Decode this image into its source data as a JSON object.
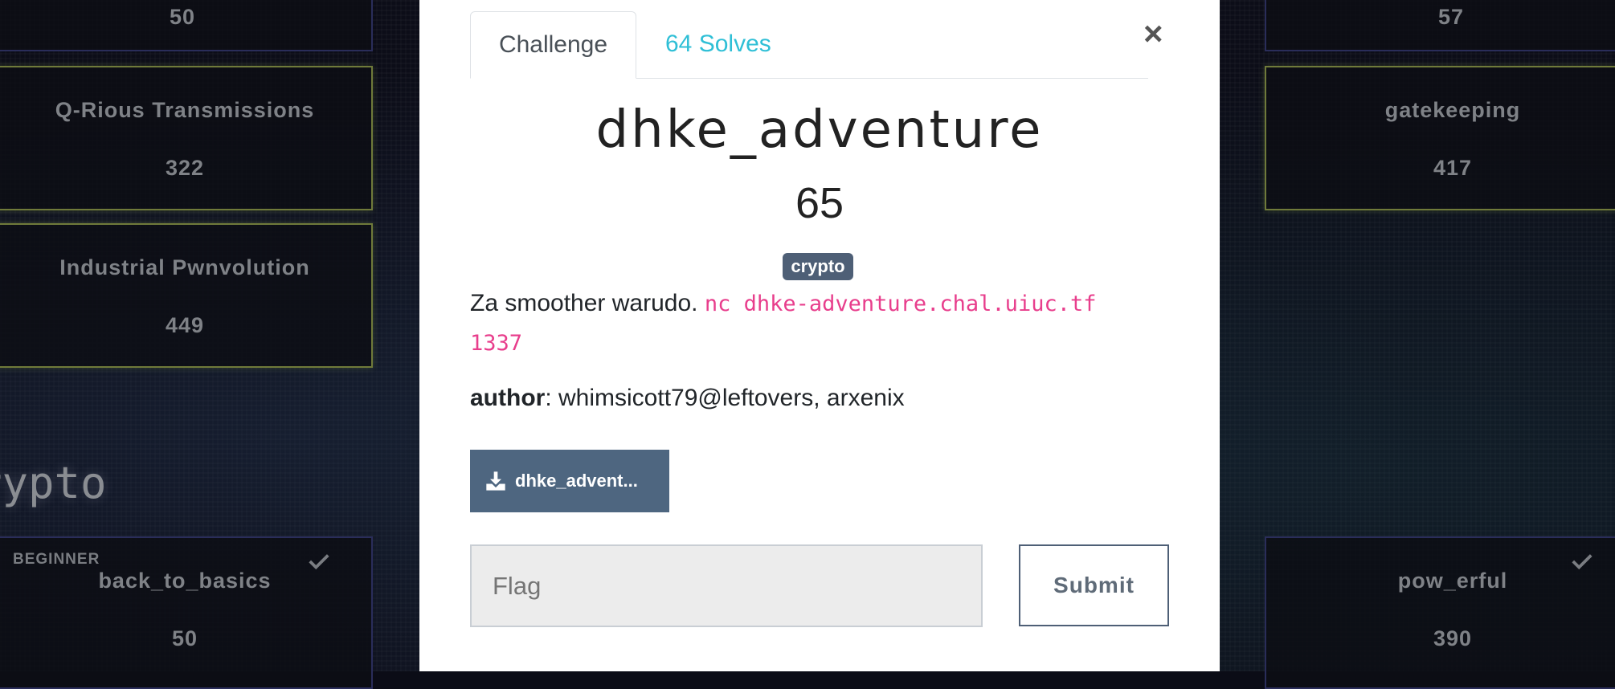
{
  "background": {
    "category_heading": "rypto",
    "cards": {
      "top_left_value": "50",
      "top_right_value": "57",
      "q_rious": {
        "name": "Q-Rious Transmissions",
        "value": "322"
      },
      "gatekeeping": {
        "name": "gatekeeping",
        "value": "417"
      },
      "industrial": {
        "name": "Industrial Pwnvolution",
        "value": "449"
      },
      "back_to_basics": {
        "tag": "BEGINNER",
        "name": "back_to_basics",
        "value": "50"
      },
      "pow_erful": {
        "name": "pow_erful",
        "value": "390"
      }
    }
  },
  "modal": {
    "tabs": {
      "challenge": "Challenge",
      "solves": "64 Solves"
    },
    "close_symbol": "×",
    "title": "dhke_adventure",
    "points": "65",
    "category_badge": "crypto",
    "description_text": "Za smoother warudo.",
    "description_code_line1": "nc dhke-adventure.chal.uiuc.tf",
    "description_code_line2": "1337",
    "author_label": "author",
    "author_value": ": whimsicott79@leftovers, arxenix",
    "file_button": "dhke_advent...",
    "flag_placeholder": "Flag",
    "submit_label": "Submit"
  },
  "colors": {
    "accent_cyan": "#2fbfd6",
    "badge_bg": "#4e5f76",
    "code_pink": "#e83e8c",
    "solved_border": "#6f7a3a"
  }
}
